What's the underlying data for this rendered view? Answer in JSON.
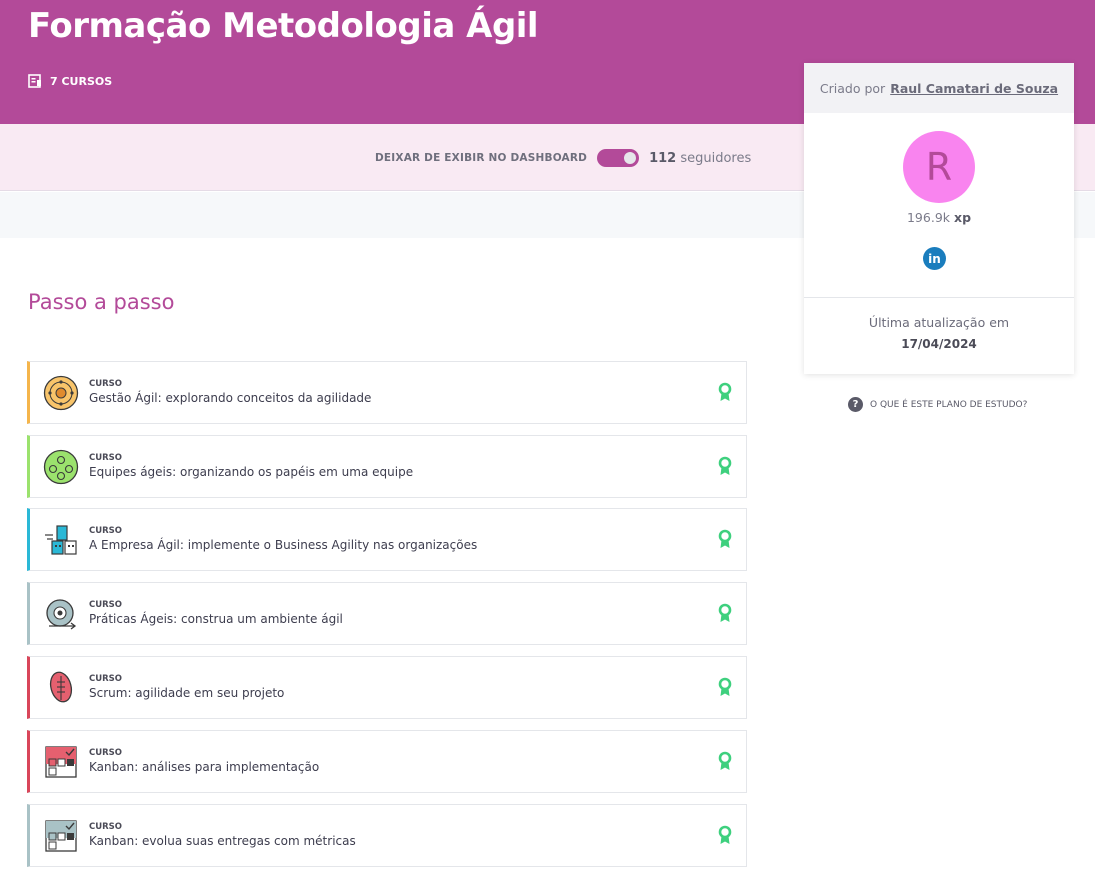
{
  "header": {
    "title": "Formação Metodologia Ágil",
    "course_count": "7 CURSOS",
    "course_count_icon": "course-list-icon"
  },
  "dashboard": {
    "toggle_label": "DEIXAR DE EXIBIR NO DASHBOARD",
    "toggle_on": true,
    "followers_count": "112",
    "followers_label": "seguidores"
  },
  "main": {
    "section_title": "Passo a passo",
    "courses": [
      {
        "type": "CURSO",
        "name": "Gestão Ágil: explorando conceitos da agilidade",
        "accent": "#f5b54b",
        "icon": "agile-management-icon"
      },
      {
        "type": "CURSO",
        "name": "Equipes ágeis: organizando os papéis em uma equipe",
        "accent": "#9be26d",
        "icon": "team-roles-icon"
      },
      {
        "type": "CURSO",
        "name": "A Empresa Ágil: implemente o Business Agility nas organizações",
        "accent": "#2ab8d6",
        "icon": "agile-company-icon"
      },
      {
        "type": "CURSO",
        "name": "Práticas Ágeis: construa um ambiente ágil",
        "accent": "#a9c2c6",
        "icon": "agile-practices-icon"
      },
      {
        "type": "CURSO",
        "name": "Scrum: agilidade em seu projeto",
        "accent": "#d9465a",
        "icon": "scrum-ball-icon"
      },
      {
        "type": "CURSO",
        "name": "Kanban: análises para implementação",
        "accent": "#d9465a",
        "icon": "kanban-board-icon"
      },
      {
        "type": "CURSO",
        "name": "Kanban: evolua suas entregas com métricas",
        "accent": "#a9c2c6",
        "icon": "kanban-metrics-icon"
      }
    ],
    "badge_color": "#3ed07e"
  },
  "sidebar": {
    "created_by_label": "Criado por",
    "author_name": "Raul Camatari de Souza",
    "avatar_letter": "R",
    "xp_value": "196.9k",
    "xp_unit": "xp",
    "linkedin_label": "in",
    "updated_label": "Última atualização em",
    "updated_date": "17/04/2024",
    "help_link": "O QUE É ESTE PLANO DE ESTUDO?"
  },
  "colors": {
    "brand": "#b34a99",
    "band_bg": "#f9eaf3",
    "avatar_bg": "#f984ef"
  }
}
